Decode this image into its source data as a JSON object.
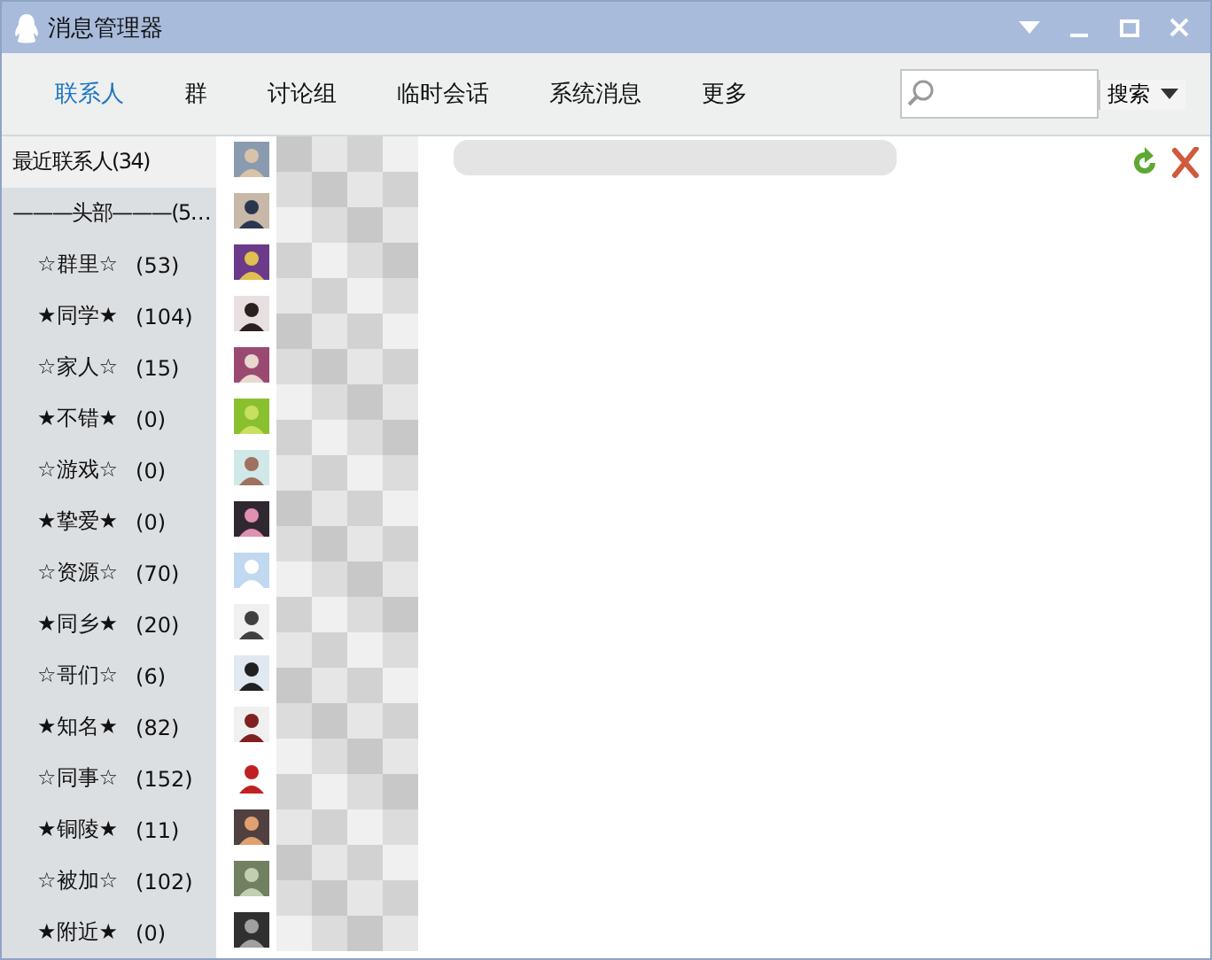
{
  "window": {
    "title": "消息管理器"
  },
  "tabs": [
    {
      "label": "联系人",
      "selected": true
    },
    {
      "label": "群",
      "selected": false
    },
    {
      "label": "讨论组",
      "selected": false
    },
    {
      "label": "临时会话",
      "selected": false
    },
    {
      "label": "系统消息",
      "selected": false
    },
    {
      "label": "更多",
      "selected": false
    }
  ],
  "search": {
    "button": "搜索"
  },
  "sidebar": {
    "items": [
      {
        "kind": "header",
        "label": "最近联系人(34)",
        "selected": true
      },
      {
        "kind": "header",
        "label": "———头部———(5…",
        "selected": false
      },
      {
        "kind": "group",
        "label": "☆群里☆",
        "count": "(53)",
        "selected": false
      },
      {
        "kind": "group",
        "label": "★同学★",
        "count": "(104)",
        "selected": false
      },
      {
        "kind": "group",
        "label": "☆家人☆",
        "count": "(15)",
        "selected": false
      },
      {
        "kind": "group",
        "label": "★不错★",
        "count": "(0)",
        "selected": false
      },
      {
        "kind": "group",
        "label": "☆游戏☆",
        "count": "(0)",
        "selected": false
      },
      {
        "kind": "group",
        "label": "★挚爱★",
        "count": "(0)",
        "selected": false
      },
      {
        "kind": "group",
        "label": "☆资源☆",
        "count": "(70)",
        "selected": false
      },
      {
        "kind": "group",
        "label": "★同乡★",
        "count": "(20)",
        "selected": false
      },
      {
        "kind": "group",
        "label": "☆哥们☆",
        "count": "(6)",
        "selected": false
      },
      {
        "kind": "group",
        "label": "★知名★",
        "count": "(82)",
        "selected": false
      },
      {
        "kind": "group",
        "label": "☆同事☆",
        "count": "(152)",
        "selected": false
      },
      {
        "kind": "group",
        "label": "★铜陵★",
        "count": "(11)",
        "selected": false
      },
      {
        "kind": "group",
        "label": "☆被加☆",
        "count": "(102)",
        "selected": false
      },
      {
        "kind": "group",
        "label": "★附近★",
        "count": "(0)",
        "selected": false
      }
    ]
  }
}
